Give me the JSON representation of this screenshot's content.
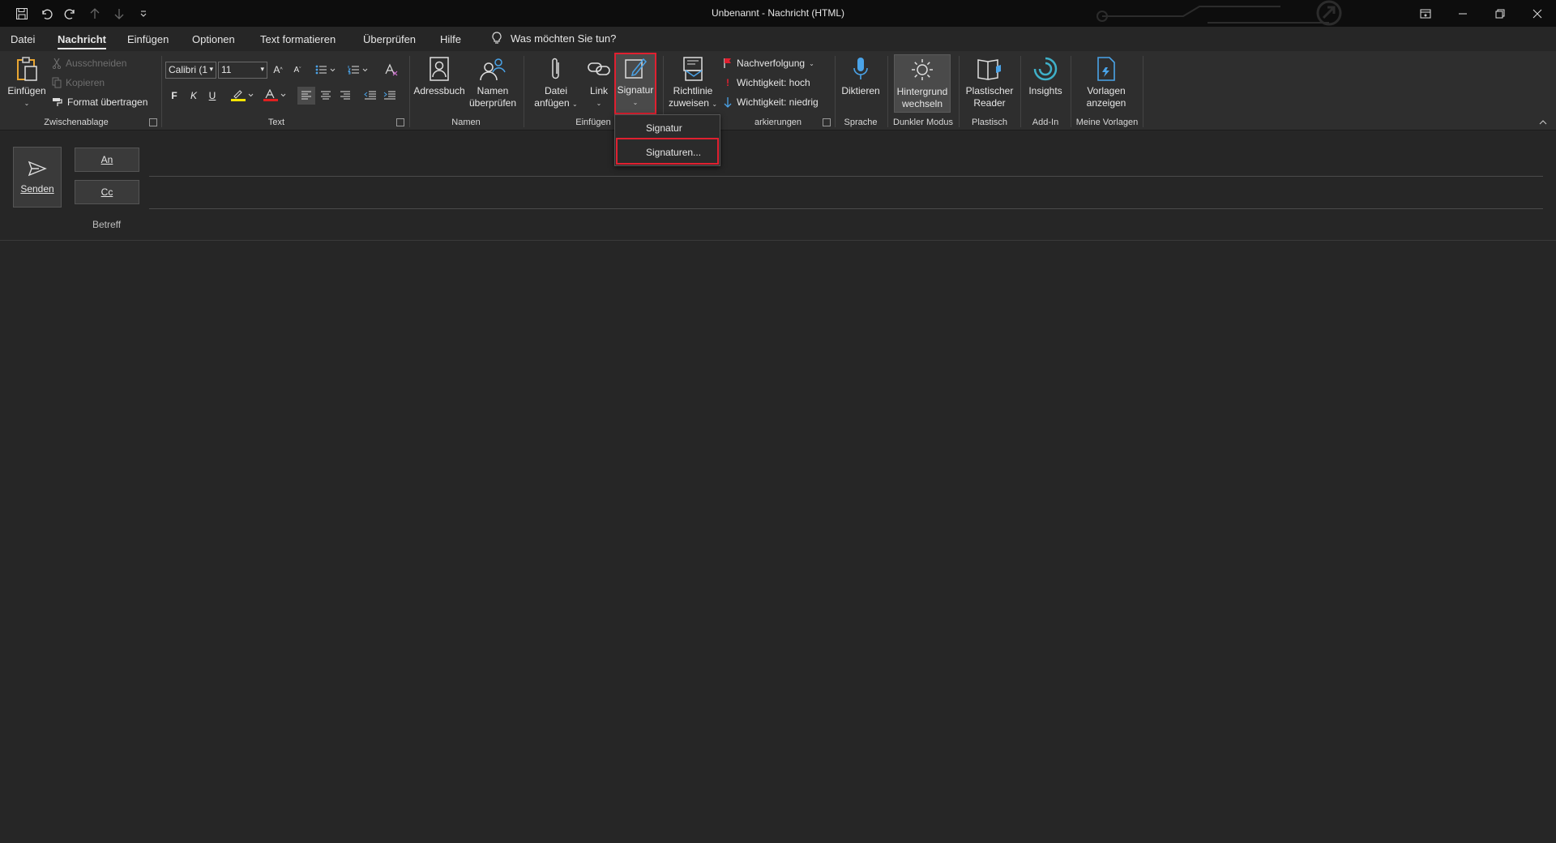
{
  "window": {
    "title": "Unbenannt  -  Nachricht (HTML)"
  },
  "menu": {
    "items": [
      "Datei",
      "Nachricht",
      "Einfügen",
      "Optionen",
      "Text formatieren",
      "Überprüfen",
      "Hilfe"
    ],
    "active": "Nachricht",
    "tell_me": "Was möchten Sie tun?"
  },
  "ribbon": {
    "clipboard": {
      "paste": "Einfügen",
      "cut": "Ausschneiden",
      "copy": "Kopieren",
      "format_painter": "Format übertragen",
      "label": "Zwischenablage"
    },
    "text": {
      "font": "Calibri (1",
      "size": "11",
      "bold": "F",
      "italic": "K",
      "underline": "U",
      "label": "Text",
      "highlight_color": "#f5e400",
      "font_color": "#e02020"
    },
    "names": {
      "address_book": "Adressbuch",
      "check_names_1": "Namen",
      "check_names_2": "überprüfen",
      "label": "Namen"
    },
    "insert": {
      "attach_1": "Datei",
      "attach_2": "anfügen",
      "link": "Link",
      "signature": "Signatur",
      "label": "Einfügen"
    },
    "tags": {
      "policy_1": "Richtlinie",
      "policy_2": "zuweisen",
      "follow_up": "Nachverfolgung",
      "high": "Wichtigkeit: hoch",
      "low": "Wichtigkeit: niedrig",
      "label": "arkierungen"
    },
    "voice": {
      "dictate": "Diktieren",
      "label": "Sprache"
    },
    "dark": {
      "toggle_1": "Hintergrund",
      "toggle_2": "wechseln",
      "label": "Dunkler Modus"
    },
    "immersive": {
      "reader_1": "Plastischer",
      "reader_2": "Reader",
      "label": "Plastisch"
    },
    "addin": {
      "insights": "Insights",
      "label": "Add-In"
    },
    "templates": {
      "view_1": "Vorlagen",
      "view_2": "anzeigen",
      "label": "Meine Vorlagen"
    }
  },
  "signature_menu": {
    "items": [
      "Signatur",
      "Signaturen..."
    ]
  },
  "compose": {
    "send": "Senden",
    "to": "An",
    "cc": "Cc",
    "subject": "Betreff"
  },
  "colors": {
    "highlight_border": "#e02030",
    "accent_blue": "#4aa3e8",
    "flag_red": "#e02030"
  }
}
